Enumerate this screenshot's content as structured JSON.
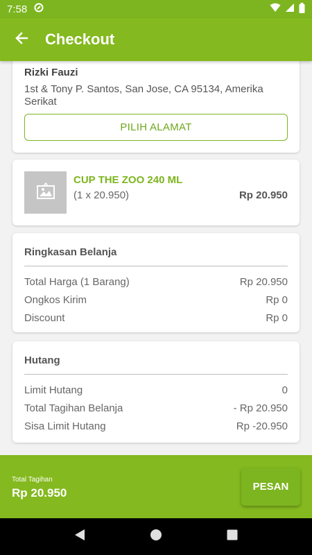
{
  "status_bar": {
    "time": "7:58"
  },
  "app_bar": {
    "title": "Checkout"
  },
  "address": {
    "name": "Rizki Fauzi",
    "line": "1st & Tony P. Santos, San Jose, CA 95134, Amerika Serikat",
    "pick_label": "PILIH ALAMAT"
  },
  "product": {
    "name": "CUP THE ZOO 240 ML",
    "qty": "(1 x 20.950)",
    "price": "Rp 20.950"
  },
  "summary": {
    "title": "Ringkasan Belanja",
    "rows": [
      {
        "label": "Total Harga (1 Barang)",
        "value": "Rp 20.950"
      },
      {
        "label": "Ongkos Kirim",
        "value": "Rp 0"
      },
      {
        "label": "Discount",
        "value": "Rp 0"
      }
    ]
  },
  "debt": {
    "title": "Hutang",
    "rows": [
      {
        "label": "Limit Hutang",
        "value": "0"
      },
      {
        "label": "Total Tagihan Belanja",
        "value": "- Rp 20.950"
      },
      {
        "label": "Sisa Limit Hutang",
        "value": "Rp -20.950"
      }
    ]
  },
  "bottom": {
    "total_label": "Total Tagihan",
    "total_value": "Rp 20.950",
    "order_label": "PESAN"
  },
  "colors": {
    "primary": "#84b91f",
    "accent": "#7cb51f"
  }
}
